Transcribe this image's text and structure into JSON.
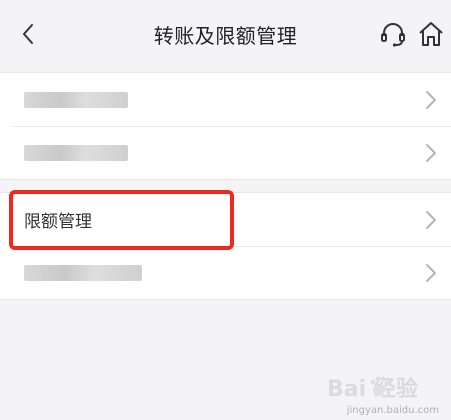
{
  "header": {
    "title": "转账及限额管理",
    "back_icon": "chevron-left-icon",
    "support_icon": "headset-icon",
    "home_icon": "home-icon"
  },
  "group1": {
    "rows": [
      {
        "label": "",
        "blurred": true
      },
      {
        "label": "",
        "blurred": true
      }
    ]
  },
  "group2": {
    "rows": [
      {
        "label": "限额管理",
        "blurred": false
      },
      {
        "label": "",
        "blurred": true
      }
    ]
  },
  "annotation": {
    "highlight_color": "#f0281e"
  },
  "watermark": {
    "brand": "Bai 经验",
    "url": "jingyan.baidu.com"
  }
}
